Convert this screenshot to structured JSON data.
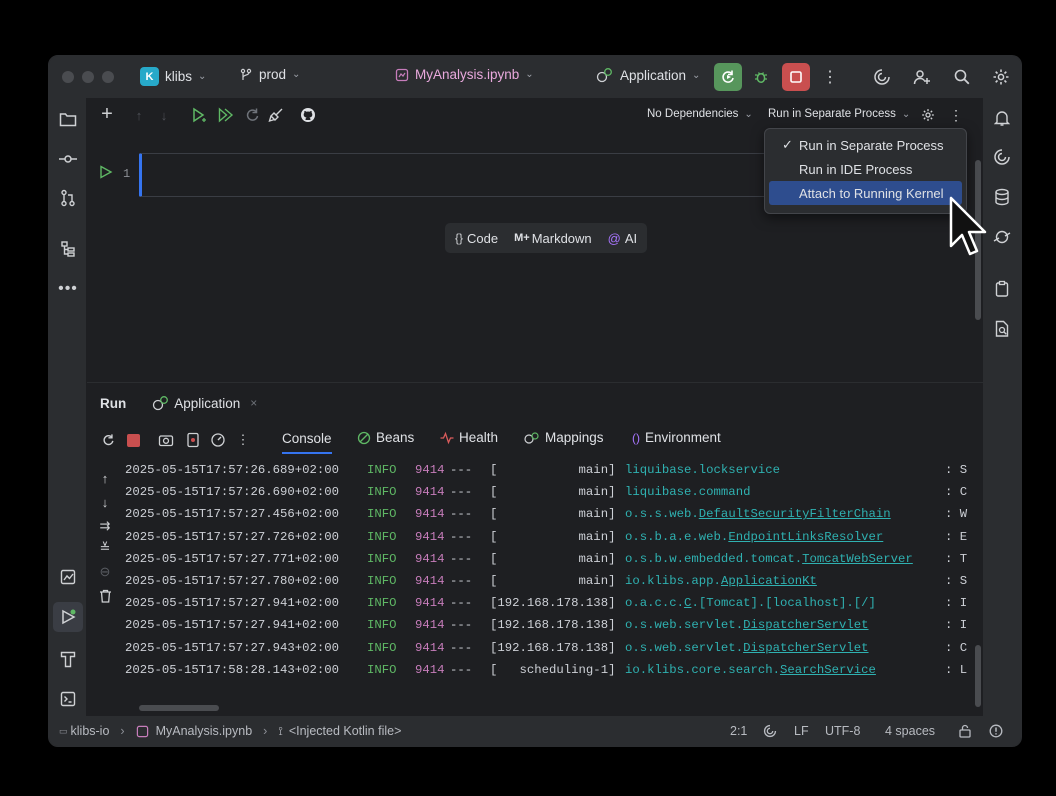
{
  "titlebar": {
    "project_badge": "K",
    "project_name": "klibs",
    "branch": "prod",
    "file": "MyAnalysis.ipynb",
    "run_config": "Application"
  },
  "notebook_toolbar": {
    "dependencies": "No Dependencies",
    "run_mode": "Run in Separate Process"
  },
  "cell": {
    "number": "1"
  },
  "add_cell_bar": {
    "code": "Code",
    "markdown": "Markdown",
    "markdown_prefix": "M+",
    "ai": "AI"
  },
  "run_mode_menu": {
    "options": [
      {
        "label": "Run in Separate Process",
        "checked": true
      },
      {
        "label": "Run in IDE Process",
        "checked": false
      },
      {
        "label": "Attach to Running Kernel",
        "checked": false,
        "highlighted": true
      }
    ]
  },
  "run_panel": {
    "title": "Run",
    "tab": "Application",
    "tabs": [
      "Console",
      "Beans",
      "Health",
      "Mappings",
      "Environment"
    ],
    "active_tab": "Console",
    "log": [
      {
        "ts": "2025-05-15T17:57:26.689+02:00",
        "level": "INFO",
        "pid": "9414",
        "sep": "---",
        "thread": "[           main]",
        "logger_prefix": "liquibase.lockservice",
        "logger_ul": "",
        "tail": ": S"
      },
      {
        "ts": "2025-05-15T17:57:26.690+02:00",
        "level": "INFO",
        "pid": "9414",
        "sep": "---",
        "thread": "[           main]",
        "logger_prefix": "liquibase.command",
        "logger_ul": "",
        "tail": ": C"
      },
      {
        "ts": "2025-05-15T17:57:27.456+02:00",
        "level": "INFO",
        "pid": "9414",
        "sep": "---",
        "thread": "[           main]",
        "logger_prefix": "o.s.s.web.",
        "logger_ul": "DefaultSecurityFilterChain",
        "tail": ": W"
      },
      {
        "ts": "2025-05-15T17:57:27.726+02:00",
        "level": "INFO",
        "pid": "9414",
        "sep": "---",
        "thread": "[           main]",
        "logger_prefix": "o.s.b.a.e.web.",
        "logger_ul": "EndpointLinksResolver",
        "tail": ": E"
      },
      {
        "ts": "2025-05-15T17:57:27.771+02:00",
        "level": "INFO",
        "pid": "9414",
        "sep": "---",
        "thread": "[           main]",
        "logger_prefix": "o.s.b.w.embedded.tomcat.",
        "logger_ul": "TomcatWebServer",
        "tail": ": T"
      },
      {
        "ts": "2025-05-15T17:57:27.780+02:00",
        "level": "INFO",
        "pid": "9414",
        "sep": "---",
        "thread": "[           main]",
        "logger_prefix": "io.klibs.app.",
        "logger_ul": "ApplicationKt",
        "tail": ": S"
      },
      {
        "ts": "2025-05-15T17:57:27.941+02:00",
        "level": "INFO",
        "pid": "9414",
        "sep": "---",
        "thread": "[192.168.178.138]",
        "logger_prefix": "o.a.c.c.",
        "logger_ul": "C",
        "logger_suffix": ".[Tomcat].[localhost].[/]",
        "tail": ": I"
      },
      {
        "ts": "2025-05-15T17:57:27.941+02:00",
        "level": "INFO",
        "pid": "9414",
        "sep": "---",
        "thread": "[192.168.178.138]",
        "logger_prefix": "o.s.web.servlet.",
        "logger_ul": "DispatcherServlet",
        "tail": ": I"
      },
      {
        "ts": "2025-05-15T17:57:27.943+02:00",
        "level": "INFO",
        "pid": "9414",
        "sep": "---",
        "thread": "[192.168.178.138]",
        "logger_prefix": "o.s.web.servlet.",
        "logger_ul": "DispatcherServlet",
        "tail": ": C"
      },
      {
        "ts": "2025-05-15T17:58:28.143+02:00",
        "level": "INFO",
        "pid": "9414",
        "sep": "---",
        "thread": "[   scheduling-1]",
        "logger_prefix": "io.klibs.core.search.",
        "logger_ul": "SearchService",
        "tail": ": L"
      }
    ]
  },
  "statusbar": {
    "project": "klibs-io",
    "file": "MyAnalysis.ipynb",
    "context": "<Injected Kotlin file>",
    "position": "2:1",
    "line_sep": "LF",
    "encoding": "UTF-8",
    "indent": "4 spaces"
  },
  "colors": {
    "accent": "#3574f0",
    "run_green": "#5fb865",
    "stop_red": "#db5c5c",
    "file_pink": "#e9a9dd"
  }
}
